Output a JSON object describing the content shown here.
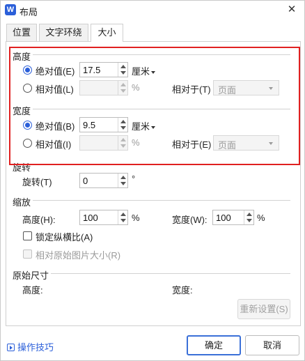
{
  "window": {
    "title": "布局",
    "app_icon": "W"
  },
  "tabs": [
    {
      "label": "位置"
    },
    {
      "label": "文字环绕"
    },
    {
      "label": "大小"
    }
  ],
  "active_tab": "大小",
  "height": {
    "section_title": "高度",
    "absolute": {
      "label": "绝对值(E)",
      "value": "17.5",
      "unit": "厘米",
      "selected": true
    },
    "relative": {
      "label": "相对值(L)",
      "value": "",
      "unit": "%",
      "relative_to_label": "相对于(T)",
      "relative_to_value": "页面",
      "selected": false
    }
  },
  "width": {
    "section_title": "宽度",
    "absolute": {
      "label": "绝对值(B)",
      "value": "9.5",
      "unit": "厘米",
      "selected": true
    },
    "relative": {
      "label": "相对值(I)",
      "value": "",
      "unit": "%",
      "relative_to_label": "相对于(E)",
      "relative_to_value": "页面",
      "selected": false
    }
  },
  "rotation": {
    "section_title": "旋转",
    "label": "旋转(T)",
    "value": "0",
    "unit": "°"
  },
  "scale": {
    "section_title": "缩放",
    "height_label": "高度(H):",
    "height_value": "100",
    "height_unit": "%",
    "width_label": "宽度(W):",
    "width_value": "100",
    "width_unit": "%",
    "lock_aspect_label": "锁定纵横比(A)",
    "lock_aspect_checked": false,
    "relative_original_label": "相对原始图片大小(R)",
    "relative_original_checked": false
  },
  "original_size": {
    "section_title": "原始尺寸",
    "height_label": "高度:",
    "width_label": "宽度:",
    "reset_label": "重新设置(S)"
  },
  "footer": {
    "tips_label": "操作技巧",
    "ok_label": "确定",
    "cancel_label": "取消"
  },
  "colors": {
    "accent": "#2b5fd9",
    "highlight": "#e02020"
  }
}
